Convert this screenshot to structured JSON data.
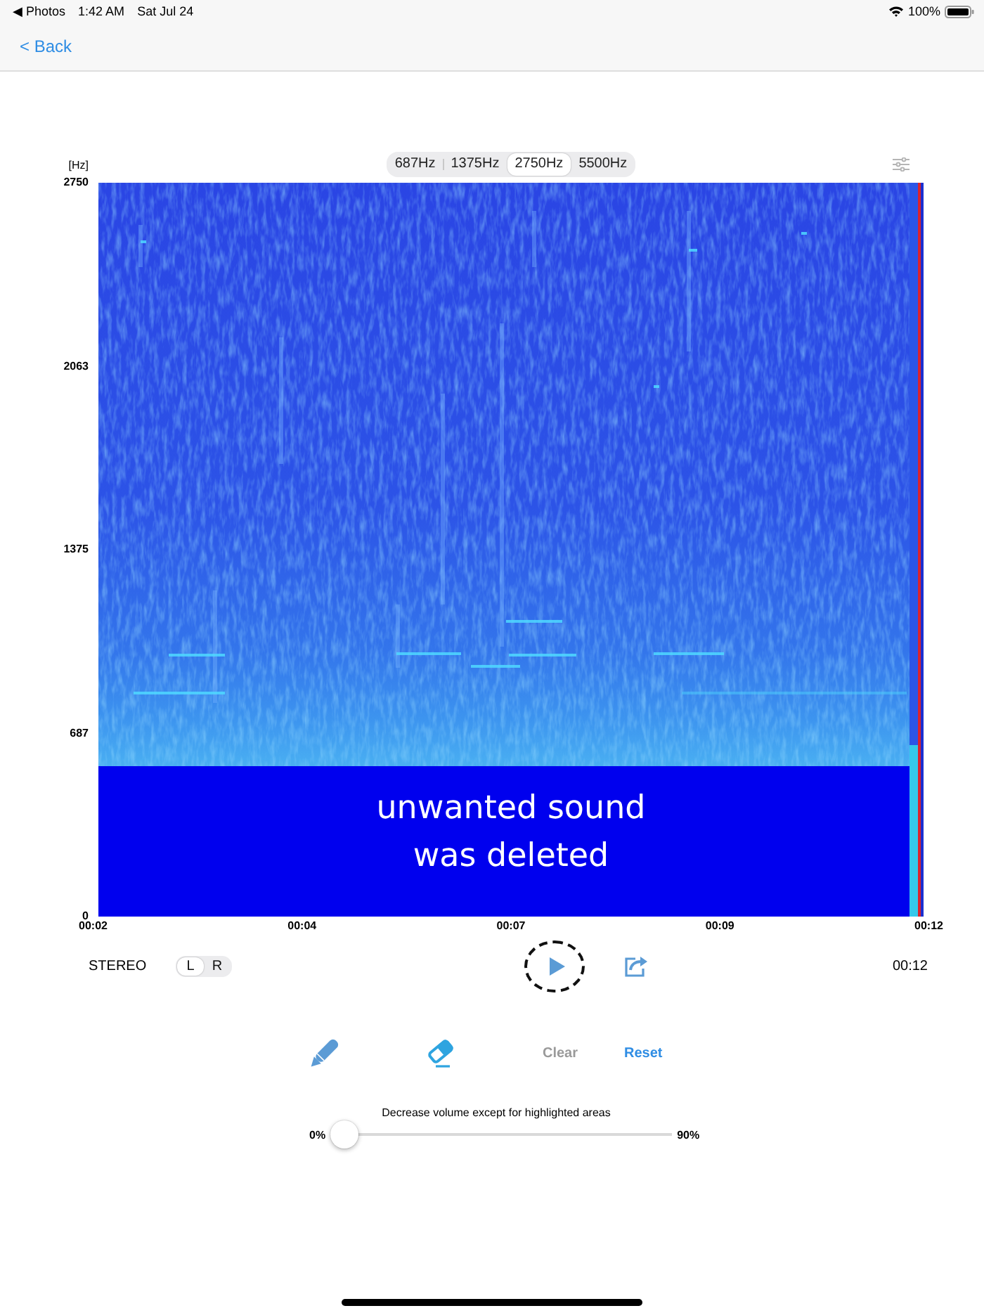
{
  "status_bar": {
    "app": "◀ Photos",
    "time": "1:42 AM",
    "date": "Sat Jul 24",
    "battery": "100%"
  },
  "nav": {
    "back": "< Back"
  },
  "spectrogram": {
    "unit": "[Hz]",
    "ranges": [
      {
        "label": "687Hz",
        "selected": false
      },
      {
        "label": "1375Hz",
        "selected": false
      },
      {
        "label": "2750Hz",
        "selected": true
      },
      {
        "label": "5500Hz",
        "selected": false
      }
    ],
    "y_labels": [
      "2750",
      "2063",
      "1375",
      "687",
      "0"
    ],
    "x_labels": [
      "00:02",
      "00:04",
      "00:07",
      "00:09",
      "00:12"
    ],
    "caption": "unwanted sound\nwas deleted"
  },
  "playback": {
    "mode": "STEREO",
    "channels": [
      {
        "label": "L",
        "selected": true
      },
      {
        "label": "R",
        "selected": false
      }
    ],
    "duration": "00:12"
  },
  "tools": [
    {
      "kind": "pencil"
    },
    {
      "kind": "eraser"
    },
    {
      "kind": "clear",
      "label": "Clear",
      "disabled": true
    },
    {
      "kind": "reset",
      "label": "Reset",
      "disabled": false
    }
  ],
  "volume": {
    "label": "Decrease volume except for highlighted areas",
    "min": "0%",
    "max": "90%",
    "level": 0
  }
}
